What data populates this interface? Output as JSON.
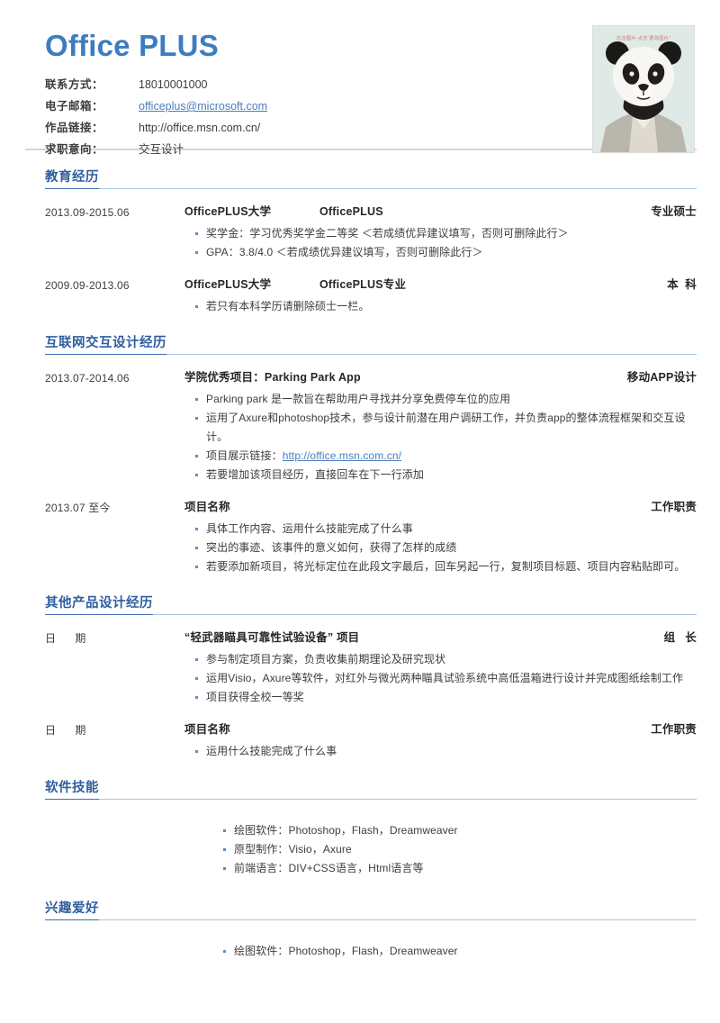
{
  "header": {
    "brand_title": "Office PLUS",
    "contacts": [
      {
        "label": "联系方式：",
        "value": "18010001000",
        "is_link": false
      },
      {
        "label": "电子邮箱：",
        "value": "officeplus@microsoft.com",
        "is_link": true
      },
      {
        "label": "作品链接：",
        "value": "http://office.msn.com.cn/",
        "is_link": false
      },
      {
        "label": "求职意向：",
        "value": "交互设计",
        "is_link": false
      }
    ],
    "photo_hint": "右击图片-点击“更改图片”"
  },
  "sections": {
    "education": {
      "heading": "教育经历",
      "entries": [
        {
          "date": "2013.09-2015.06",
          "org": "OfficePLUS大学",
          "major": "OfficePLUS",
          "right": "专业硕士",
          "bullets": [
            "奖学金：学习优秀奖学金二等奖    ＜若成绩优异建议填写，否则可删除此行＞",
            "GPA：3.8/4.0     ＜若成绩优异建议填写，否则可删除此行＞"
          ]
        },
        {
          "date": "2009.09-2013.06",
          "org": "OfficePLUS大学",
          "major": "OfficePLUS专业",
          "right": "本  科",
          "bullets": [
            "若只有本科学历请删除硕士一栏。"
          ]
        }
      ]
    },
    "internet_design": {
      "heading": "互联网交互设计经历",
      "entries": [
        {
          "date": "2013.07-2014.06",
          "org": "学院优秀项目：Parking Park App",
          "major": "",
          "right": "移动APP设计",
          "bullets": [
            "Parking park  是一款旨在帮助用户寻找并分享免费停车位的应用",
            "运用了Axure和photoshop技术，参与设计前潜在用户调研工作，并负责app的整体流程框架和交互设计。",
            "项目展示链接：http://office.msn.com.cn/",
            "若要增加该项目经历，直接回车在下一行添加"
          ],
          "link_bullet_index": 2,
          "link_prefix": "项目展示链接：",
          "link_text": "http://office.msn.com.cn/"
        },
        {
          "date": "2013.07 至今",
          "org": "项目名称",
          "major": "",
          "right": "工作职责",
          "bullets": [
            "具体工作内容、运用什么技能完成了什么事",
            "突出的事迹、该事件的意义如何，获得了怎样的成绩",
            "若要添加新项目，将光标定位在此段文字最后，回车另起一行，复制项目标题、项目内容粘贴即可。"
          ]
        }
      ]
    },
    "other_design": {
      "heading": "其他产品设计经历",
      "entries": [
        {
          "date": "日      期",
          "org": "“轻武器瞄具可靠性试验设备” 项目",
          "major": "",
          "right": "组   长",
          "bullets": [
            "参与制定项目方案，负责收集前期理论及研究现状",
            "运用Visio，Axure等软件，对红外与微光两种瞄具试验系统中高低温箱进行设计并完成图纸绘制工作",
            "项目获得全校一等奖"
          ]
        },
        {
          "date": "日      期",
          "org": "项目名称",
          "major": "",
          "right": "工作职责",
          "bullets": [
            "运用什么技能完成了什么事"
          ]
        }
      ]
    },
    "software_skills": {
      "heading": "软件技能",
      "bullets": [
        "绘图软件：Photoshop，Flash，Dreamweaver",
        "原型制作：Visio，Axure",
        "前端语言：DIV+CSS语言，Html语言等"
      ]
    },
    "hobbies": {
      "heading": "兴趣爱好",
      "bullets": [
        "绘图软件：Photoshop，Flash，Dreamweaver"
      ]
    }
  }
}
